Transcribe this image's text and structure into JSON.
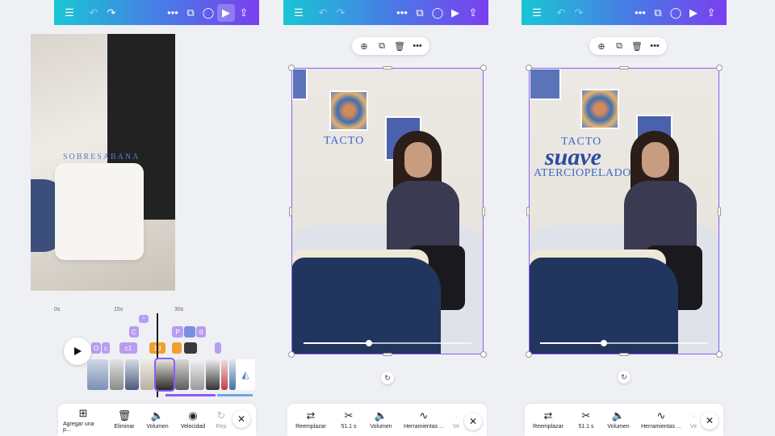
{
  "panels": [
    {
      "overlay_text": "SOBRESABANA",
      "timeline": {
        "ticks": [
          "0s",
          "15s",
          "30s"
        ],
        "chips": [
          "O",
          "c",
          "c1",
          "1d",
          "P",
          "d",
          "C",
          "+"
        ]
      },
      "bottom_bar": {
        "items": [
          {
            "label": "Agregar una p...",
            "icon": "add-page-icon"
          },
          {
            "label": "Eliminar",
            "icon": "trash-icon"
          },
          {
            "label": "Volumen",
            "icon": "volume-icon"
          },
          {
            "label": "Velocidad",
            "icon": "speed-icon"
          },
          {
            "label": "Rep",
            "icon": "repeat-icon"
          }
        ]
      }
    },
    {
      "overlay_text": "TACTO",
      "progress": 0.39,
      "bottom_bar": {
        "items": [
          {
            "label": "Reemplazar",
            "icon": "replace-icon"
          },
          {
            "label": "51.1 s",
            "icon": "scissors-icon"
          },
          {
            "label": "Volumen",
            "icon": "volume-icon"
          },
          {
            "label": "Herramientas ...",
            "icon": "waveform-icon"
          },
          {
            "label": "Ve",
            "icon": "more-icon"
          }
        ]
      }
    },
    {
      "overlay_lines": [
        "TACTO",
        "suave",
        "ATERCIOPELADO"
      ],
      "progress": 0.38,
      "bottom_bar": {
        "items": [
          {
            "label": "Reemplazar",
            "icon": "replace-icon"
          },
          {
            "label": "51.1 s",
            "icon": "scissors-icon"
          },
          {
            "label": "Volumen",
            "icon": "volume-icon"
          },
          {
            "label": "Herramientas ...",
            "icon": "waveform-icon"
          },
          {
            "label": "Ve",
            "icon": "more-icon"
          }
        ]
      }
    }
  ],
  "colors": {
    "toolbar_gradient": [
      "#19c6d4",
      "#4b78e6",
      "#7a3ff0"
    ],
    "selection": "#8b5cf6",
    "text_blue": "#3f67c9"
  }
}
